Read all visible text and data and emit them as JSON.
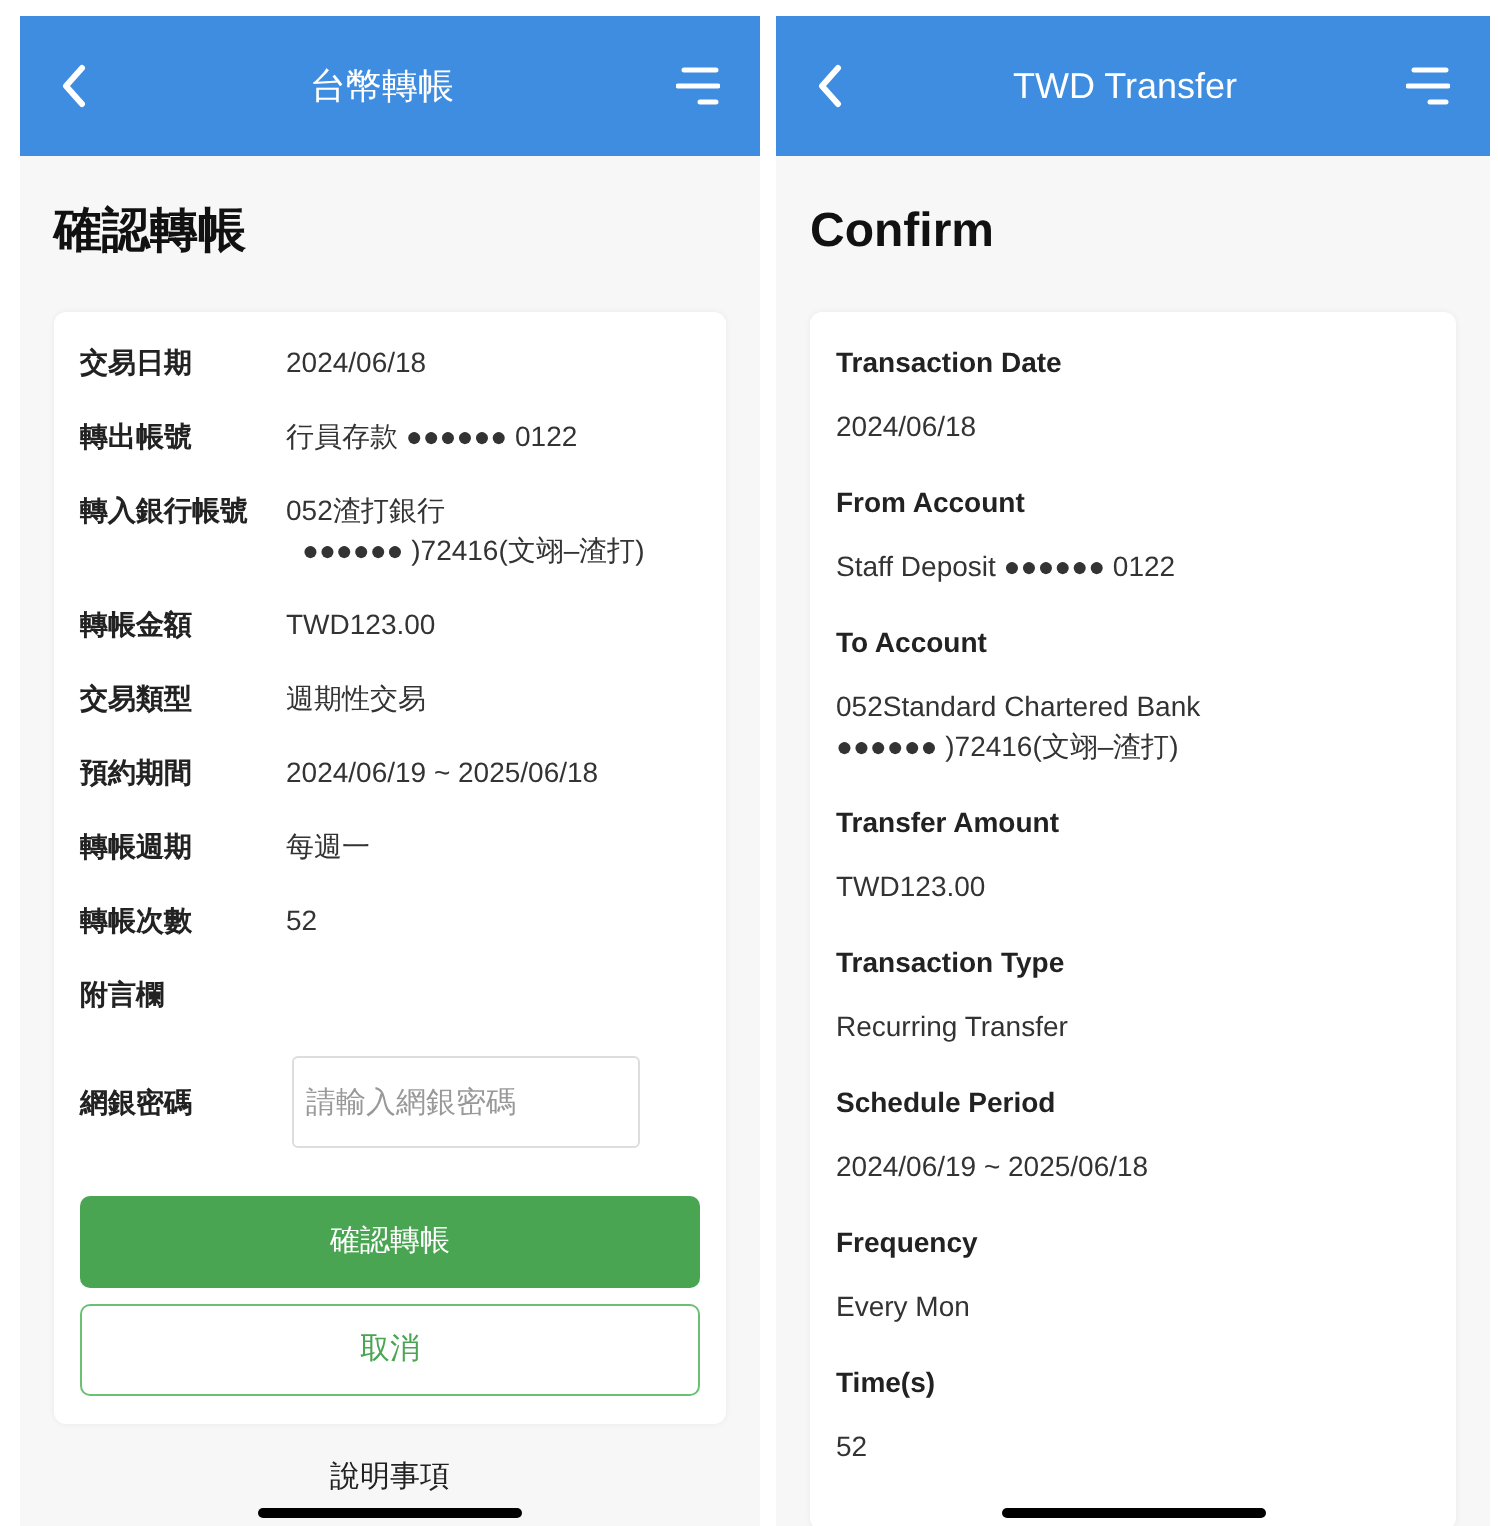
{
  "screens": [
    {
      "header": {
        "title": "台幣轉帳"
      },
      "page_title": "確認轉帳",
      "kind": "inline",
      "fields": [
        {
          "label": "交易日期",
          "value_lines": [
            "2024/06/18"
          ]
        },
        {
          "label": "轉出帳號",
          "value_lines": [
            "行員存款 ●●●●●● 0122"
          ]
        },
        {
          "label": "轉入銀行帳號",
          "value_lines": [
            "052渣打銀行",
            "●●●●●● )72416(文翊–渣打)"
          ]
        },
        {
          "label": "轉帳金額",
          "value_lines": [
            "TWD123.00"
          ]
        },
        {
          "label": "交易類型",
          "value_lines": [
            "週期性交易"
          ]
        },
        {
          "label": "預約期間",
          "value_lines": [
            "2024/06/19 ~ 2025/06/18"
          ]
        },
        {
          "label": "轉帳週期",
          "value_lines": [
            "每週一"
          ]
        },
        {
          "label": "轉帳次數",
          "value_lines": [
            "52"
          ]
        },
        {
          "label": "附言欄"
        }
      ],
      "password": {
        "label": "網銀密碼",
        "placeholder": "請輸入網銀密碼"
      },
      "buttons": [
        {
          "label": "確認轉帳",
          "kind": "primary"
        },
        {
          "label": "取消",
          "kind": "outline"
        }
      ],
      "footer_text": "說明事項"
    },
    {
      "header": {
        "title": "TWD Transfer"
      },
      "page_title": "Confirm",
      "kind": "stacked",
      "fields": [
        {
          "label": "Transaction Date",
          "value_lines": [
            "2024/06/18"
          ]
        },
        {
          "label": "From Account",
          "value_lines": [
            "Staff Deposit ●●●●●● 0122"
          ]
        },
        {
          "label": "To Account",
          "value_lines": [
            "052Standard Chartered Bank",
            "●●●●●● )72416(文翊–渣打)"
          ]
        },
        {
          "label": "Transfer Amount",
          "value_lines": [
            "TWD123.00"
          ]
        },
        {
          "label": "Transaction Type",
          "value_lines": [
            "Recurring Transfer"
          ]
        },
        {
          "label": "Schedule Period",
          "value_lines": [
            "2024/06/19 ~ 2025/06/18"
          ]
        },
        {
          "label": "Frequency",
          "value_lines": [
            "Every Mon"
          ]
        },
        {
          "label": "Time(s)",
          "value_lines": [
            "52"
          ]
        }
      ]
    }
  ]
}
